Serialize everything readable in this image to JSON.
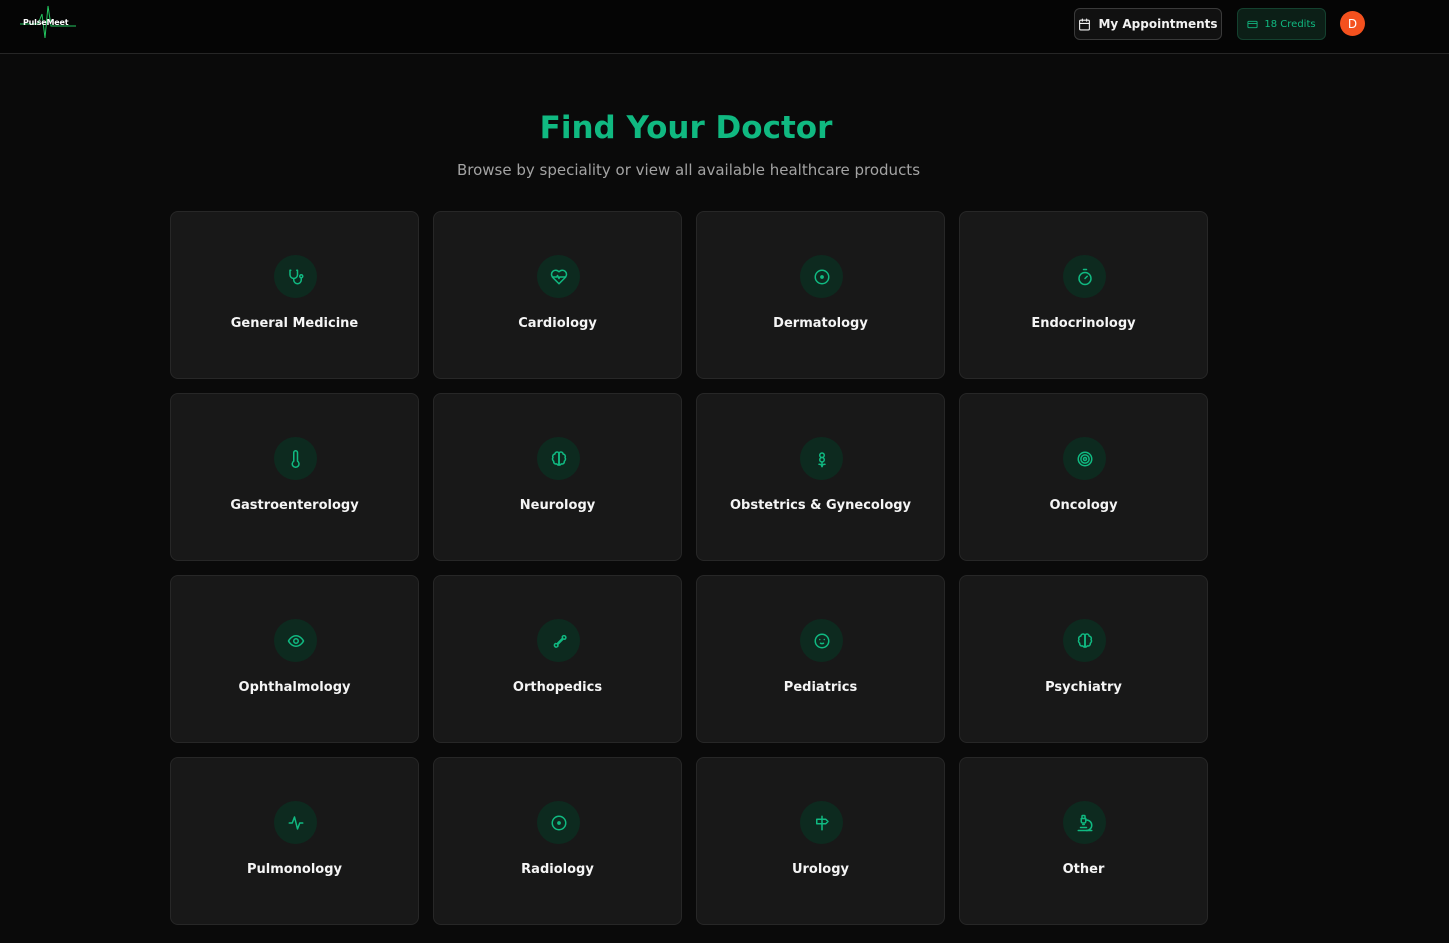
{
  "header": {
    "logo_text": "PulseMeet",
    "appointments_label": "My Appointments",
    "credits_label": "18 Credits",
    "avatar_initial": "D"
  },
  "hero": {
    "title": "Find Your Doctor",
    "subtitle": "Browse by speciality or view all available healthcare products"
  },
  "colors": {
    "accent": "#10b981",
    "background": "#0a0a0a",
    "card": "#181818",
    "avatar": "#f4511e"
  },
  "specialties": [
    {
      "label": "General Medicine",
      "icon": "stethoscope-icon"
    },
    {
      "label": "Cardiology",
      "icon": "heart-pulse-icon"
    },
    {
      "label": "Dermatology",
      "icon": "circle-dot-icon"
    },
    {
      "label": "Endocrinology",
      "icon": "timer-icon"
    },
    {
      "label": "Gastroenterology",
      "icon": "thermometer-icon"
    },
    {
      "label": "Neurology",
      "icon": "brain-icon"
    },
    {
      "label": "Obstetrics & Gynecology",
      "icon": "flower-icon"
    },
    {
      "label": "Oncology",
      "icon": "target-icon"
    },
    {
      "label": "Ophthalmology",
      "icon": "eye-icon"
    },
    {
      "label": "Orthopedics",
      "icon": "bone-icon"
    },
    {
      "label": "Pediatrics",
      "icon": "baby-icon"
    },
    {
      "label": "Psychiatry",
      "icon": "brain-icon"
    },
    {
      "label": "Pulmonology",
      "icon": "activity-icon"
    },
    {
      "label": "Radiology",
      "icon": "circle-dot-icon"
    },
    {
      "label": "Urology",
      "icon": "signpost-icon"
    },
    {
      "label": "Other",
      "icon": "microscope-icon"
    }
  ]
}
